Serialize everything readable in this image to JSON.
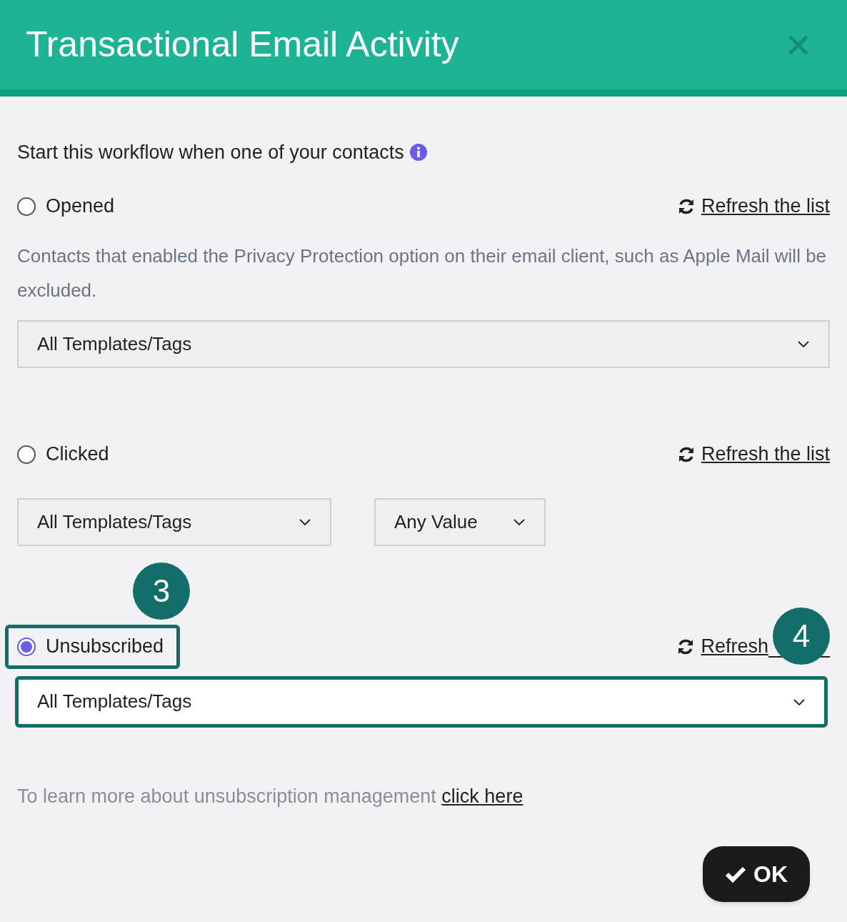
{
  "dialog": {
    "title": "Transactional Email Activity"
  },
  "intro": "Start this workflow when one of your contacts",
  "options": [
    {
      "label": "Opened",
      "selected": false,
      "highlighted": false,
      "refresh_link": "Refresh the list",
      "note": "Contacts that enabled the Privacy Protection option on their email client, such as Apple Mail will be excluded.",
      "selects": [
        {
          "value": "All Templates/Tags",
          "highlighted": false
        }
      ]
    },
    {
      "label": "Clicked",
      "selected": false,
      "highlighted": false,
      "refresh_link": "Refresh the list",
      "selects": [
        {
          "value": "All Templates/Tags",
          "highlighted": false
        },
        {
          "value": "Any Value",
          "highlighted": false
        }
      ]
    },
    {
      "label": "Unsubscribed",
      "selected": true,
      "highlighted": true,
      "label_callout": "3",
      "refresh_link": "Refresh",
      "link_callout": "4",
      "selects": [
        {
          "value": "All Templates/Tags",
          "highlighted": true
        }
      ]
    }
  ],
  "footer": {
    "text": "To learn more about unsubscription management",
    "link": "click here"
  },
  "ok_button": "OK"
}
